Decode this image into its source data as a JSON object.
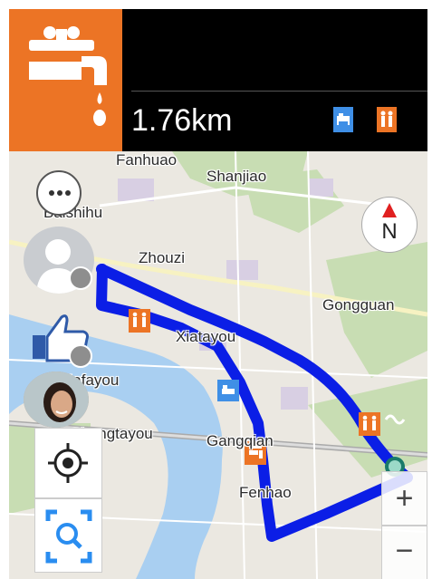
{
  "header": {
    "poi_icon": "water-tap-icon",
    "distance": "1.76km",
    "amenity_icons": [
      "hotel-bed-icon",
      "restroom-icon"
    ]
  },
  "map": {
    "labels": {
      "fanhuao": "Fanhuao",
      "shanjiao": "Shanjiao",
      "baishihu": "Baishihu",
      "zhouzi": "Zhouzi",
      "gongguan": "Gongguan",
      "xiatayou": "Xiatayou",
      "hafayou": "Hafayou",
      "shangtayou": "Shangtayou",
      "gangqian": "Gangqian",
      "fenhao": "Fenhao"
    },
    "route_color": "#0b1ee6"
  },
  "controls": {
    "more": "more-options-button",
    "compass_letter": "N",
    "zoom_in": "+",
    "zoom_out": "−"
  },
  "colors": {
    "accent_orange": "#ec7425",
    "route_blue": "#0b1ee6",
    "control_blue": "#2a8df0"
  }
}
